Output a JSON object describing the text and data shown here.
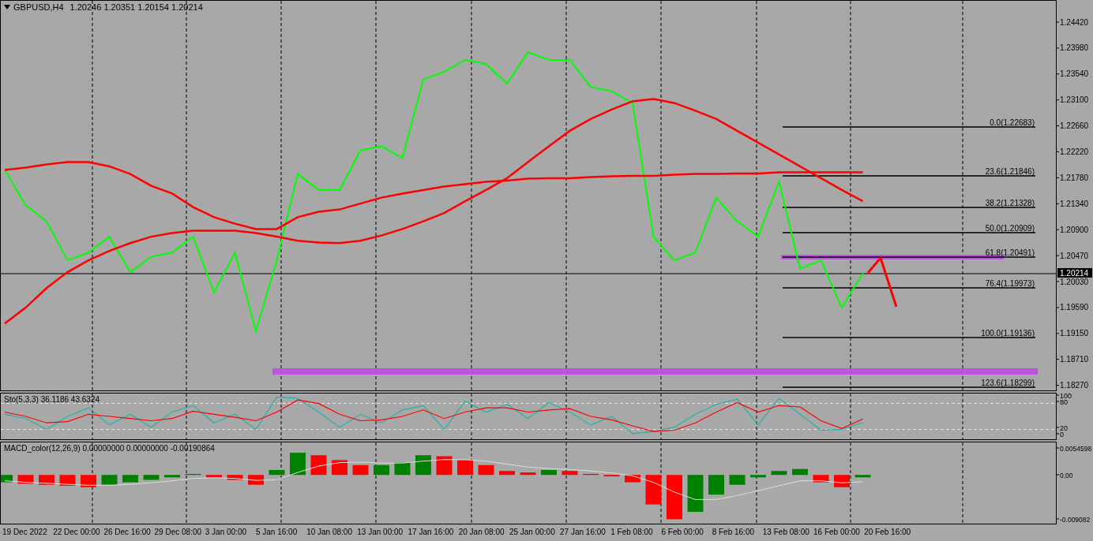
{
  "header": {
    "symbol": "GBPUSD,H4",
    "ohlc": "1.20246 1.20351 1.20154 1.20214"
  },
  "price_axis": [
    "1.24420",
    "1.23980",
    "1.23540",
    "1.23100",
    "1.22660",
    "1.22220",
    "1.21780",
    "1.21340",
    "1.20900",
    "1.20470",
    "1.20030",
    "1.19590",
    "1.19150",
    "1.18710",
    "1.18270"
  ],
  "fib_levels": [
    {
      "label": "0.0(1.22683)"
    },
    {
      "label": "23.6(1.21846)"
    },
    {
      "label": "38.2(1.21328)"
    },
    {
      "label": "50.0(1.20909)"
    },
    {
      "label": "61.8(1.20491)"
    },
    {
      "label": "76.4(1.19973)"
    },
    {
      "label": "100.0(1.19136)"
    },
    {
      "label": "123.6(1.18299)"
    }
  ],
  "current_price": "1.20214",
  "stochastic": {
    "title": "Sto(5,3,3) 36.1186 43.6324",
    "axis_labels": [
      "100",
      "80",
      "20",
      "0"
    ]
  },
  "macd": {
    "title": "MACD_color(12,26,9) 0.00000000 0.00000000 -0.00190864",
    "axis_labels": [
      "0.0054598",
      "0.00",
      "-0.009082"
    ]
  },
  "time_axis": [
    "19 Dec 2022",
    "22 Dec 00:00",
    "26 Dec 16:00",
    "29 Dec 08:00",
    "3 Jan 00:00",
    "5 Jan 16:00",
    "10 Jan 08:00",
    "13 Jan 00:00",
    "17 Jan 16:00",
    "20 Jan 08:00",
    "25 Jan 00:00",
    "27 Jan 16:00",
    "1 Feb 08:00",
    "6 Feb 00:00",
    "8 Feb 16:00",
    "13 Feb 08:00",
    "16 Feb 00:00",
    "20 Feb 16:00"
  ]
}
